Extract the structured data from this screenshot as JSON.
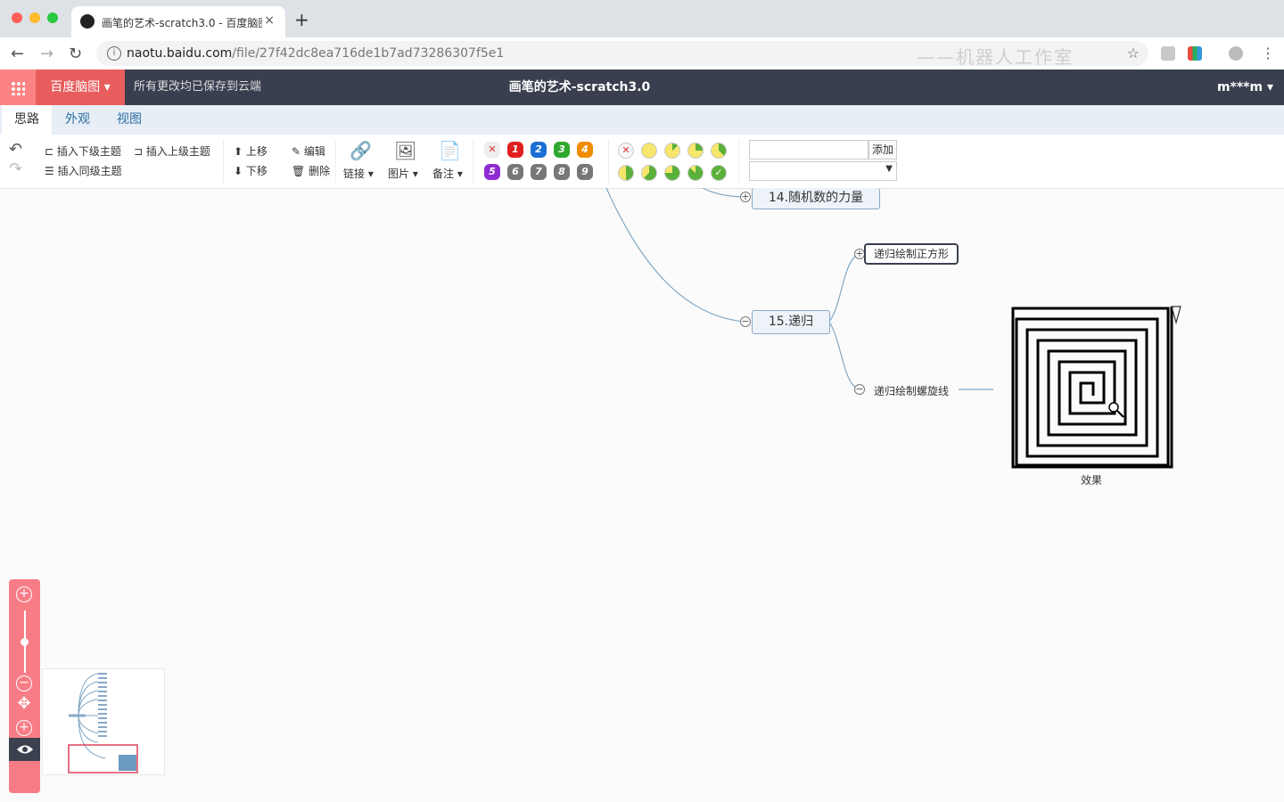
{
  "browser": {
    "tab_title": "画笔的艺术-scratch3.0 - 百度脑图",
    "new_tab": "+",
    "close": "×",
    "url_host": "naotu.baidu.com",
    "url_path": "/file/27f42dc8ea716de1b7ad73286307f5e1",
    "watermark": "——机器人工作室"
  },
  "app": {
    "brand": "百度脑图",
    "save_status": "所有更改均已保存到云端",
    "doc_title": "画笔的艺术-scratch3.0",
    "user": "m***m"
  },
  "menu_tabs": [
    "思路",
    "外观",
    "视图"
  ],
  "toolbar": {
    "insert_child": "插入下级主题",
    "insert_parent": "插入上级主题",
    "insert_sibling": "插入同级主题",
    "move_up": "上移",
    "move_down": "下移",
    "edit": "编辑",
    "delete": "删除",
    "link": "链接",
    "image": "图片",
    "note": "备注",
    "tag_add": "添加",
    "priorities": [
      "1",
      "2",
      "3",
      "4",
      "5",
      "6",
      "7",
      "8",
      "9"
    ]
  },
  "mindmap": {
    "node_14": "14.随机数的力量",
    "node_15": "15.递归",
    "child_square": "递归绘制正方形",
    "child_spiral": "递归绘制螺旋线",
    "image_caption": "效果"
  },
  "colors": {
    "header_bg": "#393f4f",
    "brand_bg": "#e85d5d",
    "accent": "#fc8383",
    "node_border": "#88a9c9",
    "line": "#7fa7c4"
  }
}
